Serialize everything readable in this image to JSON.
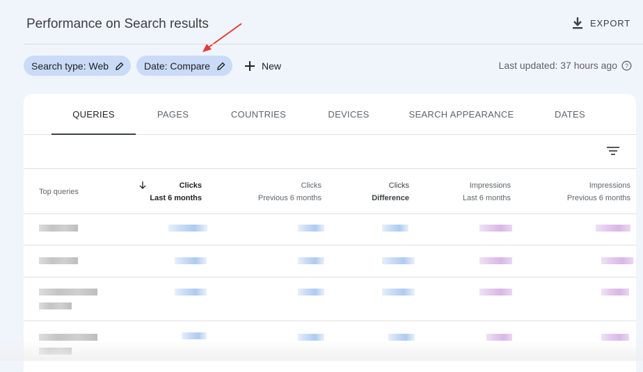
{
  "header": {
    "title": "Performance on Search results",
    "export_label": "EXPORT"
  },
  "filters": {
    "chips": [
      {
        "label": "Search type: Web"
      },
      {
        "label": "Date: Compare"
      }
    ],
    "new_label": "New",
    "last_updated": "Last updated: 37 hours ago"
  },
  "tabs": [
    {
      "label": "QUERIES",
      "active": true
    },
    {
      "label": "PAGES"
    },
    {
      "label": "COUNTRIES"
    },
    {
      "label": "DEVICES"
    },
    {
      "label": "SEARCH APPEARANCE"
    },
    {
      "label": "DATES"
    }
  ],
  "table": {
    "headers": [
      {
        "label": "Top queries"
      },
      {
        "line1": "Clicks",
        "line2": "Last 6 months",
        "sorted": true
      },
      {
        "line1": "Clicks",
        "line2": "Previous 6 months"
      },
      {
        "line1": "Clicks",
        "line2": "Difference"
      },
      {
        "line1": "Impressions",
        "line2": "Last 6 months"
      },
      {
        "line1": "Impressions",
        "line2": "Previous 6 months"
      }
    ]
  },
  "colors": {
    "chip": "#c9dbf7",
    "arrow": "#e53935"
  }
}
